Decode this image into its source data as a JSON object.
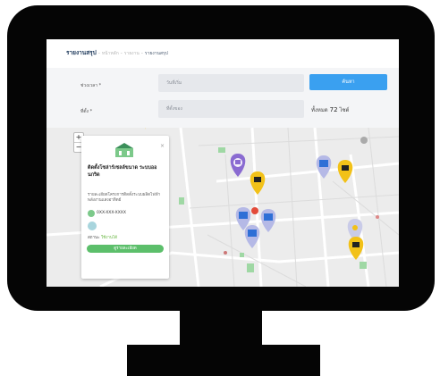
{
  "breadcrumb": {
    "title": "รายงานสรุป",
    "link1": "หน้าหลัก",
    "link2": "รายงาน",
    "current": "รายงานสรุป"
  },
  "form": {
    "field1_label": "ช่วงเวลา *",
    "field1_placeholder": "วันที่เริ่ม",
    "field2_label": "ที่ตั้ง *",
    "field2_placeholder": "ที่ตั้งของ",
    "button_label": "ค้นหา",
    "interval_prefix": "ทั้งหมด",
    "interval_value": "72",
    "interval_unit": "ไซต์"
  },
  "map": {
    "zoom_in": "+",
    "zoom_out": "−",
    "popup": {
      "close": "×",
      "name": "ติดตั้งโซล่าร์เซลล์ขนาด ระบบออนกริด",
      "description": "รายละเอียดโครงการติดตั้งระบบผลิตไฟฟ้าพลังงานแสงอาทิตย์",
      "phone": "0XX-XXX-XXXX",
      "status_label": "สถานะ",
      "status_value": "ใช้งานได้",
      "button": "ดูรายละเอียด"
    },
    "colors": {
      "pin_yellow": "#f2c118",
      "pin_purple": "#8a6bd1",
      "pin_lavender": "#b5b9e6",
      "pin_blue_icon": "#2f6fd6",
      "park_green": "#9fd8a4"
    }
  }
}
